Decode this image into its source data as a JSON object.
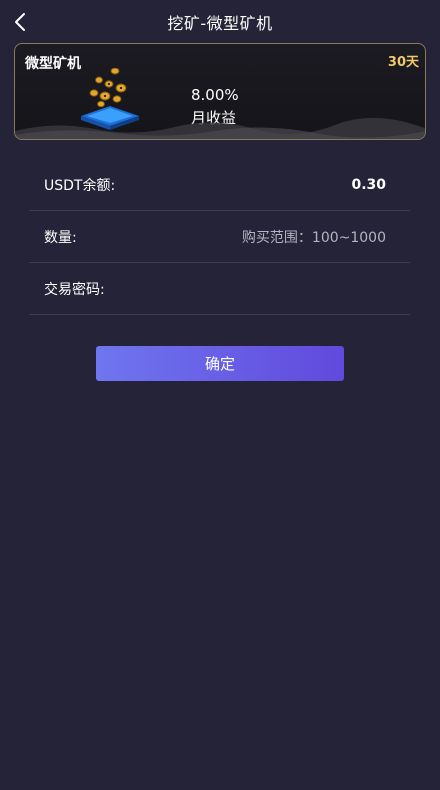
{
  "header": {
    "title": "挖矿-微型矿机",
    "back_icon": "chevron-left-icon"
  },
  "product_card": {
    "name": "微型矿机",
    "duration": "30天",
    "rate": "8.00%",
    "rate_label": "月收益",
    "icon": "coins-on-platform-icon"
  },
  "form": {
    "balance_label": "USDT余额:",
    "balance_value": "0.30",
    "quantity_label": "数量:",
    "quantity_placeholder": "购买范围：100~1000",
    "password_label": "交易密码:",
    "password_placeholder": ""
  },
  "confirm_label": "确定",
  "colors": {
    "background": "#252337",
    "accent_gold": "#f1c86b",
    "button_start": "#6f76ef",
    "button_end": "#6149dd"
  }
}
